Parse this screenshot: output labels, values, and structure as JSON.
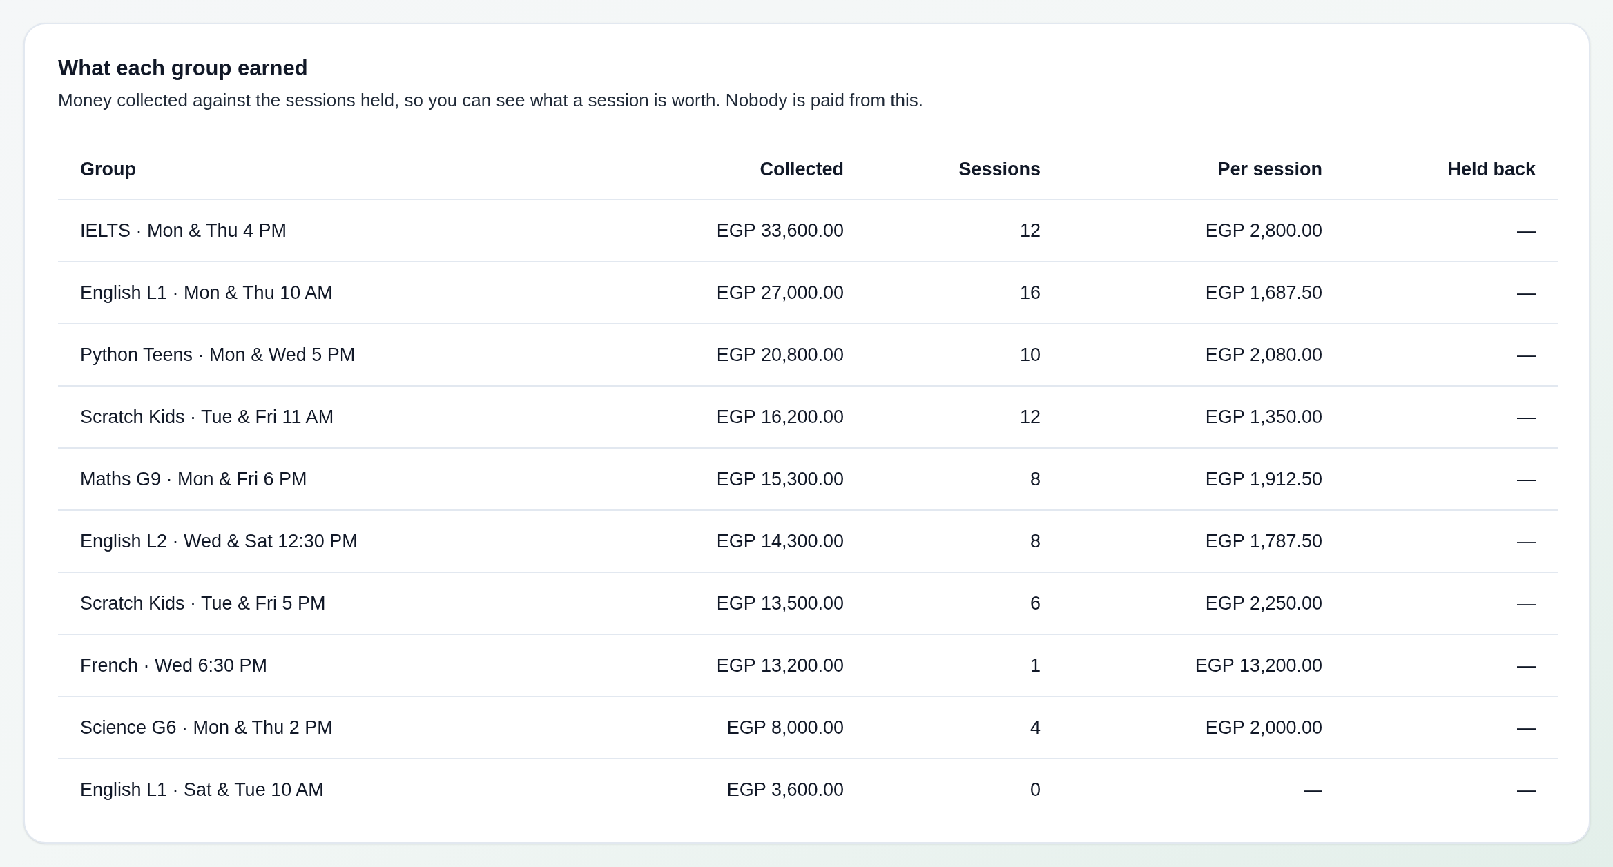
{
  "card": {
    "title": "What each group earned",
    "description": "Money collected against the sessions held, so you can see what a session is worth. Nobody is paid from this."
  },
  "table": {
    "columns": [
      "Group",
      "Collected",
      "Sessions",
      "Per session",
      "Held back"
    ],
    "rows": [
      [
        "IELTS · Mon & Thu 4 PM",
        "EGP 33,600.00",
        "12",
        "EGP 2,800.00",
        "—"
      ],
      [
        "English L1 · Mon & Thu 10 AM",
        "EGP 27,000.00",
        "16",
        "EGP 1,687.50",
        "—"
      ],
      [
        "Python Teens · Mon & Wed 5 PM",
        "EGP 20,800.00",
        "10",
        "EGP 2,080.00",
        "—"
      ],
      [
        "Scratch Kids · Tue & Fri 11 AM",
        "EGP 16,200.00",
        "12",
        "EGP 1,350.00",
        "—"
      ],
      [
        "Maths G9 · Mon & Fri 6 PM",
        "EGP 15,300.00",
        "8",
        "EGP 1,912.50",
        "—"
      ],
      [
        "English L2 · Wed & Sat 12:30 PM",
        "EGP 14,300.00",
        "8",
        "EGP 1,787.50",
        "—"
      ],
      [
        "Scratch Kids · Tue & Fri 5 PM",
        "EGP 13,500.00",
        "6",
        "EGP 2,250.00",
        "—"
      ],
      [
        "French · Wed 6:30 PM",
        "EGP 13,200.00",
        "1",
        "EGP 13,200.00",
        "—"
      ],
      [
        "Science G6 · Mon & Thu 2 PM",
        "EGP 8,000.00",
        "4",
        "EGP 2,000.00",
        "—"
      ],
      [
        "English L1 · Sat & Tue 10 AM",
        "EGP 3,600.00",
        "0",
        "—",
        "—"
      ]
    ]
  }
}
